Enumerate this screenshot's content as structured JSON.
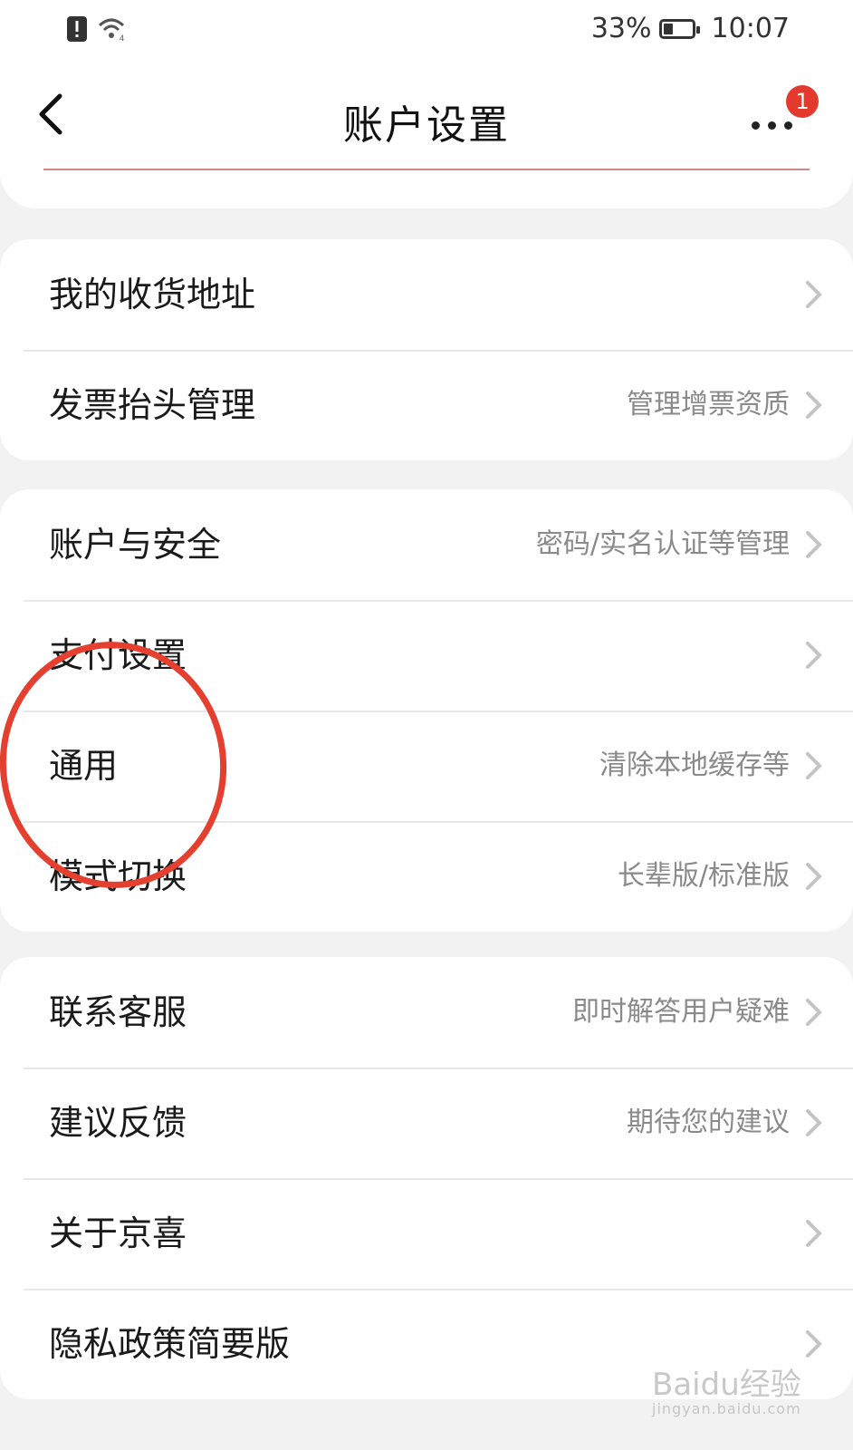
{
  "status_bar": {
    "battery": "33%",
    "battery_level": 0.33,
    "time": "10:07"
  },
  "header": {
    "title": "账户设置",
    "notification_count": "1"
  },
  "groups": [
    {
      "items": [
        {
          "label": "我的收货地址",
          "hint": ""
        },
        {
          "label": "发票抬头管理",
          "hint": "管理增票资质"
        }
      ]
    },
    {
      "items": [
        {
          "label": "账户与安全",
          "hint": "密码/实名认证等管理"
        },
        {
          "label": "支付设置",
          "hint": ""
        },
        {
          "label": "通用",
          "hint": "清除本地缓存等"
        },
        {
          "label": "模式切换",
          "hint": "长辈版/标准版"
        }
      ]
    },
    {
      "items": [
        {
          "label": "联系客服",
          "hint": "即时解答用户疑难"
        },
        {
          "label": "建议反馈",
          "hint": "期待您的建议"
        },
        {
          "label": "关于京喜",
          "hint": ""
        },
        {
          "label": "隐私政策简要版",
          "hint": ""
        }
      ]
    }
  ],
  "watermark": {
    "brand": "Baidu经验",
    "url": "jingyan.baidu.com"
  },
  "colors": {
    "accent_red": "#e43a2e",
    "annotation_circle": "#e5402f"
  }
}
